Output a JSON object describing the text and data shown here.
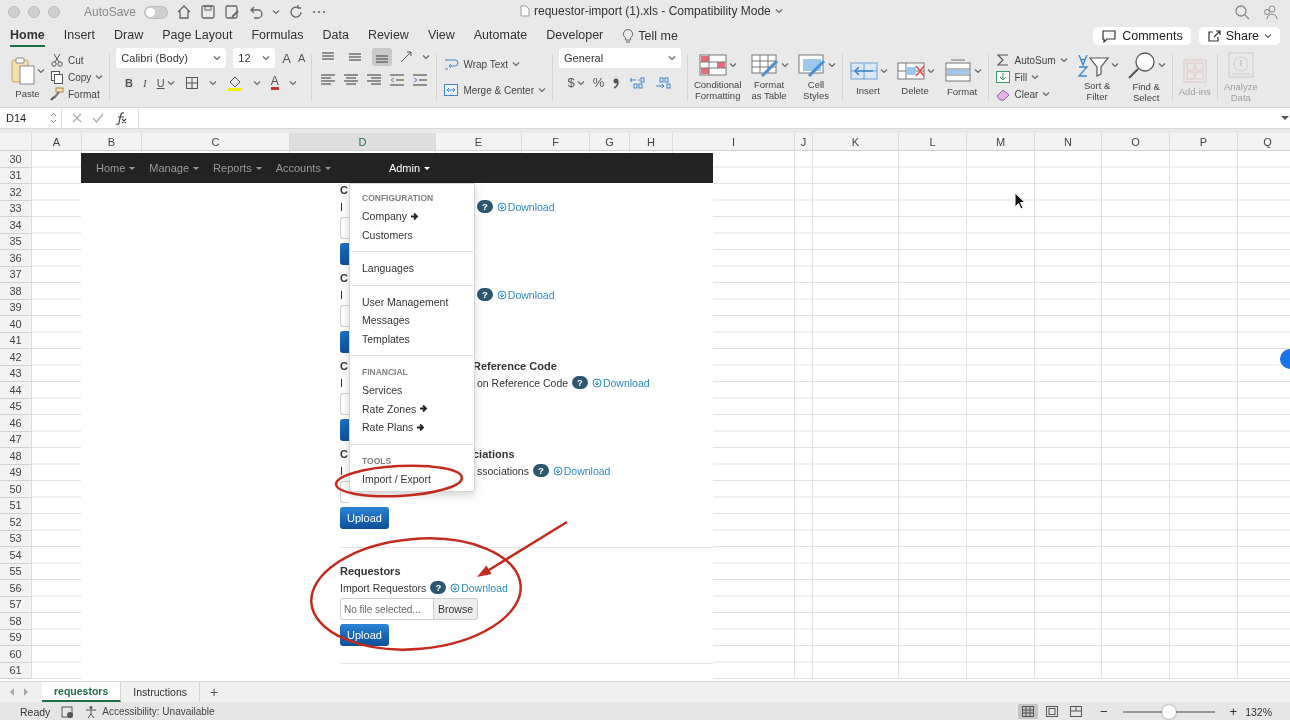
{
  "titlebar": {
    "autosave": "AutoSave",
    "autosave_on": false,
    "title": "requestor-import (1).xls - Compatibility Mode"
  },
  "ribbon_tabs": [
    {
      "label": "Home",
      "selected": true
    },
    {
      "label": "Insert",
      "selected": false
    },
    {
      "label": "Draw",
      "selected": false
    },
    {
      "label": "Page Layout",
      "selected": false
    },
    {
      "label": "Formulas",
      "selected": false
    },
    {
      "label": "Data",
      "selected": false
    },
    {
      "label": "Review",
      "selected": false
    },
    {
      "label": "View",
      "selected": false
    },
    {
      "label": "Automate",
      "selected": false
    },
    {
      "label": "Developer",
      "selected": false
    }
  ],
  "tell_me": "Tell me",
  "comments": "Comments",
  "share": "Share",
  "clipboard": {
    "paste": "Paste",
    "cut": "Cut",
    "copy": "Copy",
    "format": "Format"
  },
  "font": {
    "family": "Calibri (Body)",
    "size": "12",
    "grow": "A",
    "shrink": "A",
    "bold": "B",
    "italic": "I",
    "underline": "U",
    "color_button": "A"
  },
  "alignment": {
    "vertical_align": [
      {
        "selected": false
      },
      {
        "selected": false
      },
      {
        "selected": true
      }
    ],
    "wrap": "Wrap Text",
    "merge": "Merge & Center"
  },
  "number": {
    "format": "General",
    "currency": "$",
    "percent": "%"
  },
  "commands": [
    {
      "kind": "conditional",
      "label": "Conditional\nFormatting",
      "disabled": false
    },
    {
      "kind": "table",
      "label": "Format\nas Table",
      "disabled": false
    },
    {
      "kind": "styles",
      "label": "Cell\nStyles",
      "disabled": false
    },
    {
      "kind": "insert",
      "label": "Insert",
      "disabled": false
    },
    {
      "kind": "delete",
      "label": "Delete",
      "disabled": false
    },
    {
      "kind": "format",
      "label": "Format",
      "disabled": false
    },
    {
      "kind": "stack",
      "items": [
        {
          "kind": "autosum",
          "label": "AutoSum"
        },
        {
          "kind": "fill",
          "label": "Fill"
        },
        {
          "kind": "clear",
          "label": "Clear"
        }
      ]
    },
    {
      "kind": "sort",
      "label": "Sort &\nFilter",
      "disabled": false
    },
    {
      "kind": "find",
      "label": "Find &\nSelect",
      "disabled": false
    },
    {
      "kind": "addins",
      "label": "Add-ins",
      "disabled": true
    },
    {
      "kind": "analyze",
      "label": "Analyze\nData",
      "disabled": true
    }
  ],
  "formula_bar": {
    "name_box": "D14"
  },
  "columns": [
    {
      "label": "A",
      "selected": false
    },
    {
      "label": "B",
      "selected": false
    },
    {
      "label": "C",
      "selected": false
    },
    {
      "label": "D",
      "selected": true
    },
    {
      "label": "E",
      "selected": false
    },
    {
      "label": "F",
      "selected": false
    },
    {
      "label": "G",
      "selected": false
    },
    {
      "label": "H",
      "selected": false
    },
    {
      "label": "I",
      "selected": false
    },
    {
      "label": "J",
      "selected": false
    },
    {
      "label": "K",
      "selected": false
    },
    {
      "label": "L",
      "selected": false
    },
    {
      "label": "M",
      "selected": false
    },
    {
      "label": "N",
      "selected": false
    },
    {
      "label": "O",
      "selected": false
    },
    {
      "label": "P",
      "selected": false
    },
    {
      "label": "Q",
      "selected": false
    }
  ],
  "rows": [
    "30",
    "31",
    "32",
    "33",
    "34",
    "35",
    "36",
    "37",
    "38",
    "39",
    "40",
    "41",
    "42",
    "43",
    "44",
    "45",
    "46",
    "47",
    "48",
    "49",
    "50",
    "51",
    "52",
    "53",
    "54",
    "55",
    "56",
    "57",
    "58",
    "59",
    "60",
    "61"
  ],
  "webpage": {
    "nav": [
      {
        "label": "Home",
        "selected": false
      },
      {
        "label": "Manage",
        "selected": false
      },
      {
        "label": "Reports",
        "selected": false
      },
      {
        "label": "Accounts",
        "selected": false
      },
      {
        "label": "Admin",
        "selected": true
      }
    ],
    "sections": [
      {
        "kind": "covered",
        "title_left": "C",
        "line_left": "I",
        "help": "?",
        "download": "Download"
      },
      {
        "kind": "covered",
        "title_left": "C",
        "line_left": "I",
        "help": "?",
        "download": "Download"
      },
      {
        "kind": "covered",
        "title_left": "C",
        "title_right": "Reference Code",
        "line_left": "I",
        "line_right": "on Reference Code",
        "help": "?",
        "download": "Download"
      },
      {
        "kind": "covered",
        "title_left": "C",
        "title_right": "ciations",
        "line_left": "I",
        "line_right": "ssociations",
        "help": "?",
        "download": "Download",
        "upload": "Upload"
      },
      {
        "kind": "full",
        "title": "Requestors",
        "line": "Import Requestors",
        "help": "?",
        "download": "Download",
        "file_placeholder": "No file selected...",
        "browse": "Browse",
        "upload": "Upload"
      }
    ],
    "admin_menu": [
      {
        "kind": "header",
        "label": "CONFIGURATION"
      },
      {
        "kind": "item",
        "label": "Company",
        "submenu": true
      },
      {
        "kind": "item",
        "label": "Customers",
        "submenu": false
      },
      {
        "kind": "divider"
      },
      {
        "kind": "item",
        "label": "Languages",
        "submenu": false
      },
      {
        "kind": "divider"
      },
      {
        "kind": "item",
        "label": "User Management",
        "submenu": false
      },
      {
        "kind": "item",
        "label": "Messages",
        "submenu": false
      },
      {
        "kind": "item",
        "label": "Templates",
        "submenu": false
      },
      {
        "kind": "divider"
      },
      {
        "kind": "header",
        "label": "FINANCIAL"
      },
      {
        "kind": "item",
        "label": "Services",
        "submenu": false
      },
      {
        "kind": "item",
        "label": "Rate Zones",
        "submenu": true
      },
      {
        "kind": "item",
        "label": "Rate Plans",
        "submenu": true
      },
      {
        "kind": "divider"
      },
      {
        "kind": "header",
        "label": "TOOLS"
      },
      {
        "kind": "item",
        "label": "Import / Export",
        "submenu": false
      }
    ]
  },
  "sheet_tabs": [
    {
      "label": "requestors",
      "selected": true
    },
    {
      "label": "Instructions",
      "selected": false
    }
  ],
  "add_sheet": "+",
  "status": {
    "ready": "Ready",
    "accessibility": "Accessibility: Unavailable",
    "views": [
      {
        "selected": true
      },
      {
        "selected": false
      },
      {
        "selected": false
      }
    ],
    "zoom_out": "−",
    "zoom_in": "+",
    "zoom": {
      "level": 0.5
    },
    "zoom_label": "132%"
  }
}
